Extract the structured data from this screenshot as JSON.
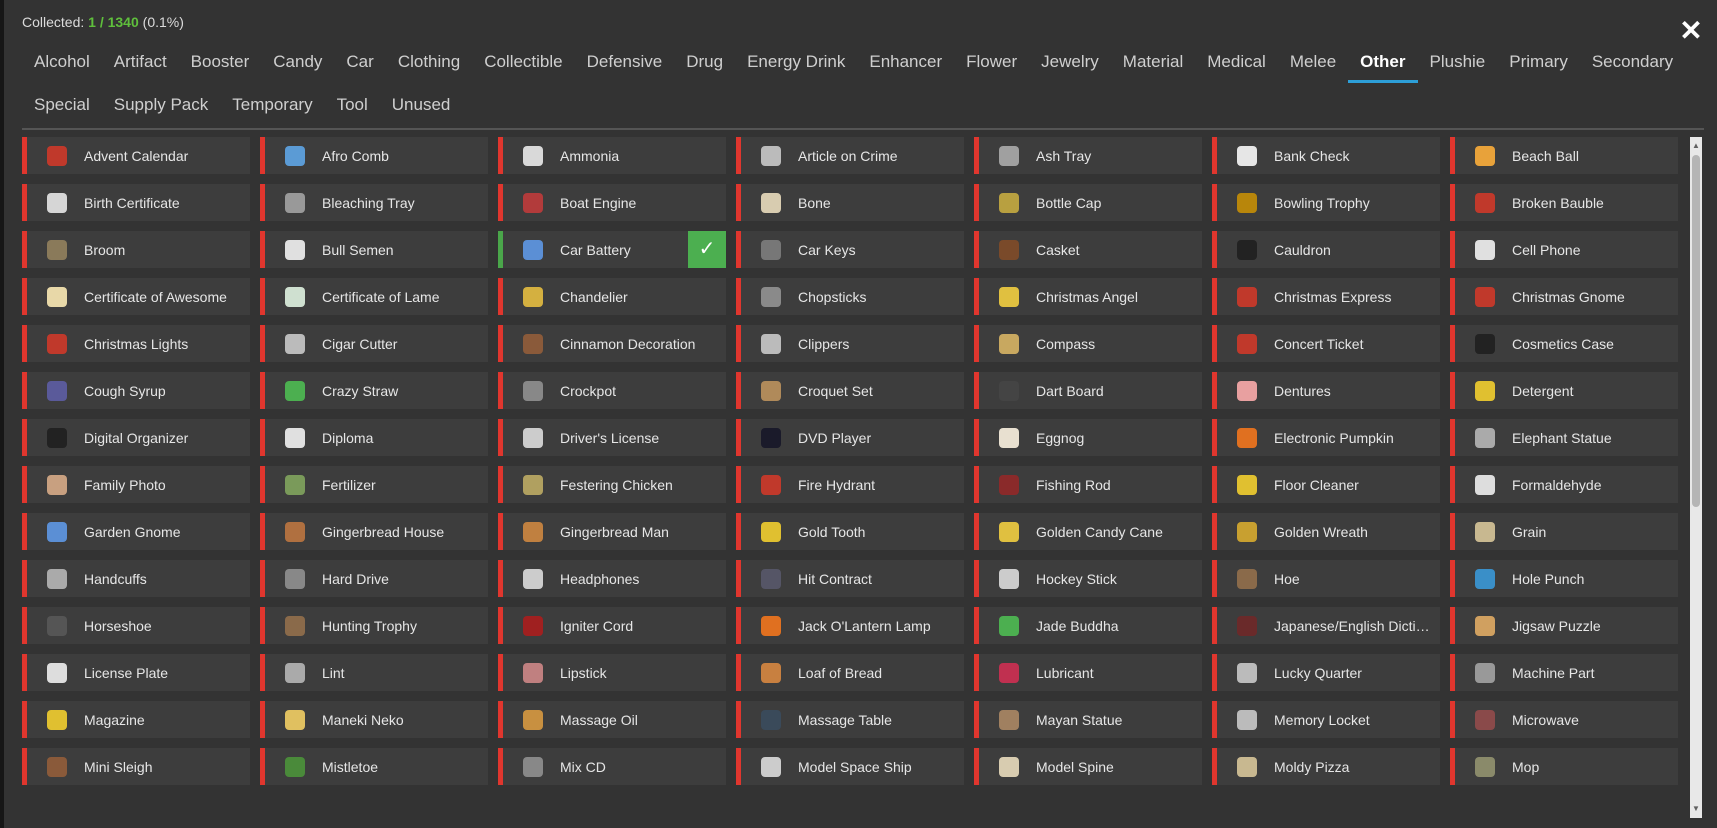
{
  "header": {
    "collected_label": "Collected:",
    "collected_count": "1 / 1340",
    "collected_percent": "(0.1%)"
  },
  "close_symbol": "✕",
  "check_symbol": "✓",
  "tabs_row1": [
    {
      "label": "Alcohol"
    },
    {
      "label": "Artifact"
    },
    {
      "label": "Booster"
    },
    {
      "label": "Candy"
    },
    {
      "label": "Car"
    },
    {
      "label": "Clothing"
    },
    {
      "label": "Collectible"
    },
    {
      "label": "Defensive"
    },
    {
      "label": "Drug"
    },
    {
      "label": "Energy Drink"
    },
    {
      "label": "Enhancer"
    },
    {
      "label": "Flower"
    },
    {
      "label": "Jewelry"
    },
    {
      "label": "Material"
    },
    {
      "label": "Medical"
    },
    {
      "label": "Melee"
    },
    {
      "label": "Other",
      "active": true
    },
    {
      "label": "Plushie"
    },
    {
      "label": "Primary"
    },
    {
      "label": "Secondary"
    }
  ],
  "tabs_row2": [
    {
      "label": "Special"
    },
    {
      "label": "Supply Pack"
    },
    {
      "label": "Temporary"
    },
    {
      "label": "Tool"
    },
    {
      "label": "Unused"
    }
  ],
  "colors": {
    "uncollected": "#e0362e",
    "collected": "#4caf50",
    "active_tab": "#2d9fd8"
  },
  "items": [
    {
      "label": "Advent Calendar",
      "icon": "advent-calendar-icon",
      "color": "#c0392b"
    },
    {
      "label": "Afro Comb",
      "icon": "afro-comb-icon",
      "color": "#5b9bd5"
    },
    {
      "label": "Ammonia",
      "icon": "ammonia-icon",
      "color": "#d9d9d9"
    },
    {
      "label": "Article on Crime",
      "icon": "article-icon",
      "color": "#bbbbbb"
    },
    {
      "label": "Ash Tray",
      "icon": "ash-tray-icon",
      "color": "#a0a0a0"
    },
    {
      "label": "Bank Check",
      "icon": "bank-check-icon",
      "color": "#e6e6e6"
    },
    {
      "label": "Beach Ball",
      "icon": "beach-ball-icon",
      "color": "#e8a23a"
    },
    {
      "label": "Birth Certificate",
      "icon": "certificate-icon",
      "color": "#d6d6d6"
    },
    {
      "label": "Bleaching Tray",
      "icon": "tray-icon",
      "color": "#999999"
    },
    {
      "label": "Boat Engine",
      "icon": "engine-icon",
      "color": "#b23b3b"
    },
    {
      "label": "Bone",
      "icon": "bone-icon",
      "color": "#d8ccb0"
    },
    {
      "label": "Bottle Cap",
      "icon": "bottle-cap-icon",
      "color": "#b8a040"
    },
    {
      "label": "Bowling Trophy",
      "icon": "trophy-icon",
      "color": "#b8860b"
    },
    {
      "label": "Broken Bauble",
      "icon": "bauble-icon",
      "color": "#c0392b"
    },
    {
      "label": "Broom",
      "icon": "broom-icon",
      "color": "#8a7a5a"
    },
    {
      "label": "Bull Semen",
      "icon": "vial-icon",
      "color": "#e0e0e0"
    },
    {
      "label": "Car Battery",
      "icon": "battery-icon",
      "color": "#5b8fd5",
      "collected": true
    },
    {
      "label": "Car Keys",
      "icon": "keys-icon",
      "color": "#777777"
    },
    {
      "label": "Casket",
      "icon": "casket-icon",
      "color": "#7a4a2a"
    },
    {
      "label": "Cauldron",
      "icon": "cauldron-icon",
      "color": "#222222"
    },
    {
      "label": "Cell Phone",
      "icon": "phone-icon",
      "color": "#e0e0e0"
    },
    {
      "label": "Certificate of Awesome",
      "icon": "certificate-icon",
      "color": "#e8d8a8"
    },
    {
      "label": "Certificate of Lame",
      "icon": "certificate-icon",
      "color": "#cfe0d0"
    },
    {
      "label": "Chandelier",
      "icon": "chandelier-icon",
      "color": "#d4b040"
    },
    {
      "label": "Chopsticks",
      "icon": "chopsticks-icon",
      "color": "#8a8a8a"
    },
    {
      "label": "Christmas Angel",
      "icon": "angel-icon",
      "color": "#e0c040"
    },
    {
      "label": "Christmas Express",
      "icon": "train-icon",
      "color": "#c0392b"
    },
    {
      "label": "Christmas Gnome",
      "icon": "gnome-icon",
      "color": "#c0392b"
    },
    {
      "label": "Christmas Lights",
      "icon": "lights-icon",
      "color": "#c0392b"
    },
    {
      "label": "Cigar Cutter",
      "icon": "cigar-cutter-icon",
      "color": "#bbbbbb"
    },
    {
      "label": "Cinnamon Decoration",
      "icon": "cinnamon-icon",
      "color": "#8a5a3a"
    },
    {
      "label": "Clippers",
      "icon": "clippers-icon",
      "color": "#bbbbbb"
    },
    {
      "label": "Compass",
      "icon": "compass-icon",
      "color": "#c8a860"
    },
    {
      "label": "Concert Ticket",
      "icon": "ticket-icon",
      "color": "#c0392b"
    },
    {
      "label": "Cosmetics Case",
      "icon": "case-icon",
      "color": "#222222"
    },
    {
      "label": "Cough Syrup",
      "icon": "syrup-icon",
      "color": "#5a5a9a"
    },
    {
      "label": "Crazy Straw",
      "icon": "straw-icon",
      "color": "#4caf50"
    },
    {
      "label": "Crockpot",
      "icon": "crockpot-icon",
      "color": "#888888"
    },
    {
      "label": "Croquet Set",
      "icon": "croquet-icon",
      "color": "#b08a5a"
    },
    {
      "label": "Dart Board",
      "icon": "dart-board-icon",
      "color": "#444444"
    },
    {
      "label": "Dentures",
      "icon": "dentures-icon",
      "color": "#e8a0a0"
    },
    {
      "label": "Detergent",
      "icon": "detergent-icon",
      "color": "#e0c030"
    },
    {
      "label": "Digital Organizer",
      "icon": "organizer-icon",
      "color": "#222222"
    },
    {
      "label": "Diploma",
      "icon": "diploma-icon",
      "color": "#e0e0e0"
    },
    {
      "label": "Driver's License",
      "icon": "license-icon",
      "color": "#cccccc"
    },
    {
      "label": "DVD Player",
      "icon": "dvd-icon",
      "color": "#1a1a2a"
    },
    {
      "label": "Eggnog",
      "icon": "eggnog-icon",
      "color": "#e8e0d0"
    },
    {
      "label": "Electronic Pumpkin",
      "icon": "pumpkin-icon",
      "color": "#e07020"
    },
    {
      "label": "Elephant Statue",
      "icon": "elephant-icon",
      "color": "#aaaaaa"
    },
    {
      "label": "Family Photo",
      "icon": "photo-icon",
      "color": "#c8a080"
    },
    {
      "label": "Fertilizer",
      "icon": "fertilizer-icon",
      "color": "#7a9a5a"
    },
    {
      "label": "Festering Chicken",
      "icon": "chicken-icon",
      "color": "#b0a060"
    },
    {
      "label": "Fire Hydrant",
      "icon": "hydrant-icon",
      "color": "#c0392b"
    },
    {
      "label": "Fishing Rod",
      "icon": "fishing-rod-icon",
      "color": "#8a2a2a"
    },
    {
      "label": "Floor Cleaner",
      "icon": "cleaner-icon",
      "color": "#e0c030"
    },
    {
      "label": "Formaldehyde",
      "icon": "jar-icon",
      "color": "#dddddd"
    },
    {
      "label": "Garden Gnome",
      "icon": "gnome-icon",
      "color": "#5b8fd5"
    },
    {
      "label": "Gingerbread House",
      "icon": "gingerbread-house-icon",
      "color": "#b07040"
    },
    {
      "label": "Gingerbread Man",
      "icon": "gingerbread-man-icon",
      "color": "#c08040"
    },
    {
      "label": "Gold Tooth",
      "icon": "tooth-icon",
      "color": "#e0c030"
    },
    {
      "label": "Golden Candy Cane",
      "icon": "candy-cane-icon",
      "color": "#e0c040"
    },
    {
      "label": "Golden Wreath",
      "icon": "wreath-icon",
      "color": "#c8a030"
    },
    {
      "label": "Grain",
      "icon": "grain-icon",
      "color": "#c8b890"
    },
    {
      "label": "Handcuffs",
      "icon": "handcuffs-icon",
      "color": "#aaaaaa"
    },
    {
      "label": "Hard Drive",
      "icon": "hard-drive-icon",
      "color": "#888888"
    },
    {
      "label": "Headphones",
      "icon": "headphones-icon",
      "color": "#cccccc"
    },
    {
      "label": "Hit Contract",
      "icon": "contract-icon",
      "color": "#555566"
    },
    {
      "label": "Hockey Stick",
      "icon": "hockey-stick-icon",
      "color": "#cccccc"
    },
    {
      "label": "Hoe",
      "icon": "hoe-icon",
      "color": "#8a6a4a"
    },
    {
      "label": "Hole Punch",
      "icon": "hole-punch-icon",
      "color": "#3a8fc8"
    },
    {
      "label": "Horseshoe",
      "icon": "horseshoe-icon",
      "color": "#555555"
    },
    {
      "label": "Hunting Trophy",
      "icon": "antler-icon",
      "color": "#8a6a4a"
    },
    {
      "label": "Igniter Cord",
      "icon": "cord-icon",
      "color": "#a02020"
    },
    {
      "label": "Jack O'Lantern Lamp",
      "icon": "pumpkin-icon",
      "color": "#e07020"
    },
    {
      "label": "Jade Buddha",
      "icon": "buddha-icon",
      "color": "#4caf50"
    },
    {
      "label": "Japanese/English Dictionary",
      "icon": "book-icon",
      "color": "#6a2a2a"
    },
    {
      "label": "Jigsaw Puzzle",
      "icon": "puzzle-icon",
      "color": "#d0a060"
    },
    {
      "label": "License Plate",
      "icon": "license-plate-icon",
      "color": "#dddddd"
    },
    {
      "label": "Lint",
      "icon": "lint-icon",
      "color": "#aaaaaa"
    },
    {
      "label": "Lipstick",
      "icon": "lipstick-icon",
      "color": "#c08080"
    },
    {
      "label": "Loaf of Bread",
      "icon": "bread-icon",
      "color": "#c88040"
    },
    {
      "label": "Lubricant",
      "icon": "lubricant-icon",
      "color": "#c03050"
    },
    {
      "label": "Lucky Quarter",
      "icon": "coin-icon",
      "color": "#bbbbbb"
    },
    {
      "label": "Machine Part",
      "icon": "gear-part-icon",
      "color": "#999999"
    },
    {
      "label": "Magazine",
      "icon": "magazine-icon",
      "color": "#e0c030"
    },
    {
      "label": "Maneki Neko",
      "icon": "cat-icon",
      "color": "#e0c060"
    },
    {
      "label": "Massage Oil",
      "icon": "oil-icon",
      "color": "#c89040"
    },
    {
      "label": "Massage Table",
      "icon": "table-icon",
      "color": "#3a4a5a"
    },
    {
      "label": "Mayan Statue",
      "icon": "statue-icon",
      "color": "#a08060"
    },
    {
      "label": "Memory Locket",
      "icon": "locket-icon",
      "color": "#bbbbbb"
    },
    {
      "label": "Microwave",
      "icon": "microwave-icon",
      "color": "#8a4a4a"
    },
    {
      "label": "Mini Sleigh",
      "icon": "sleigh-icon",
      "color": "#8a5a3a"
    },
    {
      "label": "Mistletoe",
      "icon": "mistletoe-icon",
      "color": "#4a8a3a"
    },
    {
      "label": "Mix CD",
      "icon": "cd-icon",
      "color": "#888888"
    },
    {
      "label": "Model Space Ship",
      "icon": "rocket-icon",
      "color": "#cccccc"
    },
    {
      "label": "Model Spine",
      "icon": "spine-icon",
      "color": "#d8ccb0"
    },
    {
      "label": "Moldy Pizza",
      "icon": "pizza-icon",
      "color": "#c8b890"
    },
    {
      "label": "Mop",
      "icon": "mop-icon",
      "color": "#8a8a6a"
    }
  ]
}
